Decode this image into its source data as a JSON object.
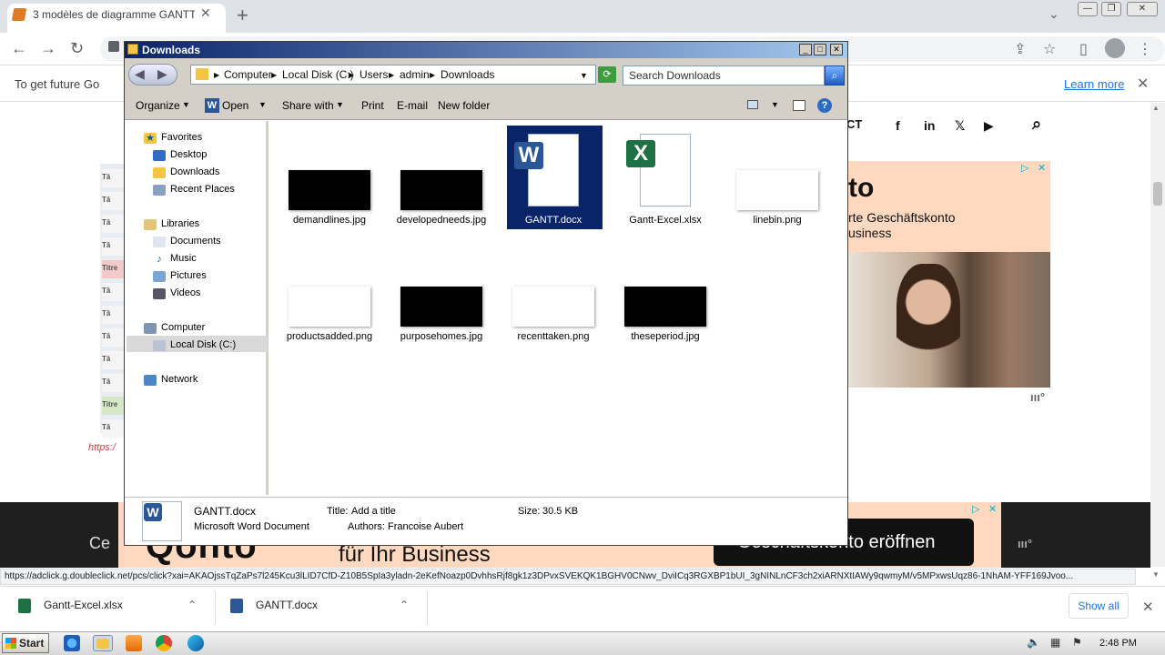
{
  "browser": {
    "tab_title": "3 modèles de diagramme GANTT vierges",
    "tab_close": "✕",
    "new_tab": "+",
    "tabs_dropdown": "⌄",
    "infobar_text": "To get future Go",
    "learn_more": "Learn more",
    "status_url": "https://adclick.g.doubleclick.net/pcs/click?xai=AKAOjssTqZaPs7l245Kcu3lLID7CfD-Z10B5SpIa3yladn-2eKefNoazp0DvhhsRjf8gk1z3DPvxSVEKQK1BGHV0CNwv_DviICq3RGXBP1bUI_3gNINLnCF3ch2xiARNXtIAWy9qwmyM/v5MPxwsUqz86-1NhAM-YFF169Jvoo...",
    "downloads": [
      {
        "name": "Gantt-Excel.xlsx",
        "type": "excel"
      },
      {
        "name": "GANTT.docx",
        "type": "word"
      }
    ],
    "show_all": "Show all"
  },
  "page": {
    "header_text": "CT",
    "link_text": "https:/",
    "left_cells": [
      "Tâ",
      "Tâ",
      "Tâ",
      "Tâ",
      "Titre",
      "Tâ",
      "Tâ",
      "Tâ",
      "Tâ",
      "Tâ",
      "Titre",
      "Tâ"
    ],
    "ad_top": {
      "title": "to",
      "line1": "rte Geschäftskonto",
      "line2": "usiness"
    },
    "ad_bottom": {
      "lead": "Ce",
      "logo": "Qonto",
      "tagline": "für Ihr Business",
      "button": "Geschäftskonto eröffnen"
    }
  },
  "explorer": {
    "title": "Downloads",
    "breadcrumb": [
      "Computer",
      "Local Disk (C:)",
      "Users",
      "admin",
      "Downloads"
    ],
    "search_placeholder": "Search Downloads",
    "toolbar": {
      "organize": "Organize",
      "open": "Open",
      "share_with": "Share with",
      "print": "Print",
      "email": "E-mail",
      "new_folder": "New folder"
    },
    "nav": {
      "favorites": "Favorites",
      "desktop": "Desktop",
      "downloads": "Downloads",
      "recent_places": "Recent Places",
      "libraries": "Libraries",
      "documents": "Documents",
      "music": "Music",
      "pictures": "Pictures",
      "videos": "Videos",
      "computer": "Computer",
      "local_disk": "Local Disk (C:)",
      "network": "Network"
    },
    "files": [
      {
        "name": "demandlines.jpg",
        "thumb": "#000000"
      },
      {
        "name": "developedneeds.jpg",
        "thumb": "#000000"
      },
      {
        "name": "GANTT.docx",
        "thumb": "word",
        "selected": true
      },
      {
        "name": "Gantt-Excel.xlsx",
        "thumb": "excel"
      },
      {
        "name": "linebin.png",
        "thumb": "#ffffff"
      },
      {
        "name": "productsadded.png",
        "thumb": "#ffffff"
      },
      {
        "name": "purposehomes.jpg",
        "thumb": "#000000"
      },
      {
        "name": "recenttaken.png",
        "thumb": "#ffffff"
      },
      {
        "name": "theseperiod.jpg",
        "thumb": "#000000"
      }
    ],
    "details": {
      "filename": "GANTT.docx",
      "type": "Microsoft Word Document",
      "title_label": "Title:",
      "title_value": "Add a title",
      "authors_label": "Authors:",
      "authors_value": "Francoise Aubert",
      "size_label": "Size:",
      "size_value": "30.5 KB"
    }
  },
  "taskbar": {
    "start": "Start",
    "time": "2:48 PM"
  },
  "colors": {
    "selection": "#0a246a",
    "word": "#2b5797",
    "excel": "#1e7145",
    "accent_link": "#1a73e8"
  }
}
